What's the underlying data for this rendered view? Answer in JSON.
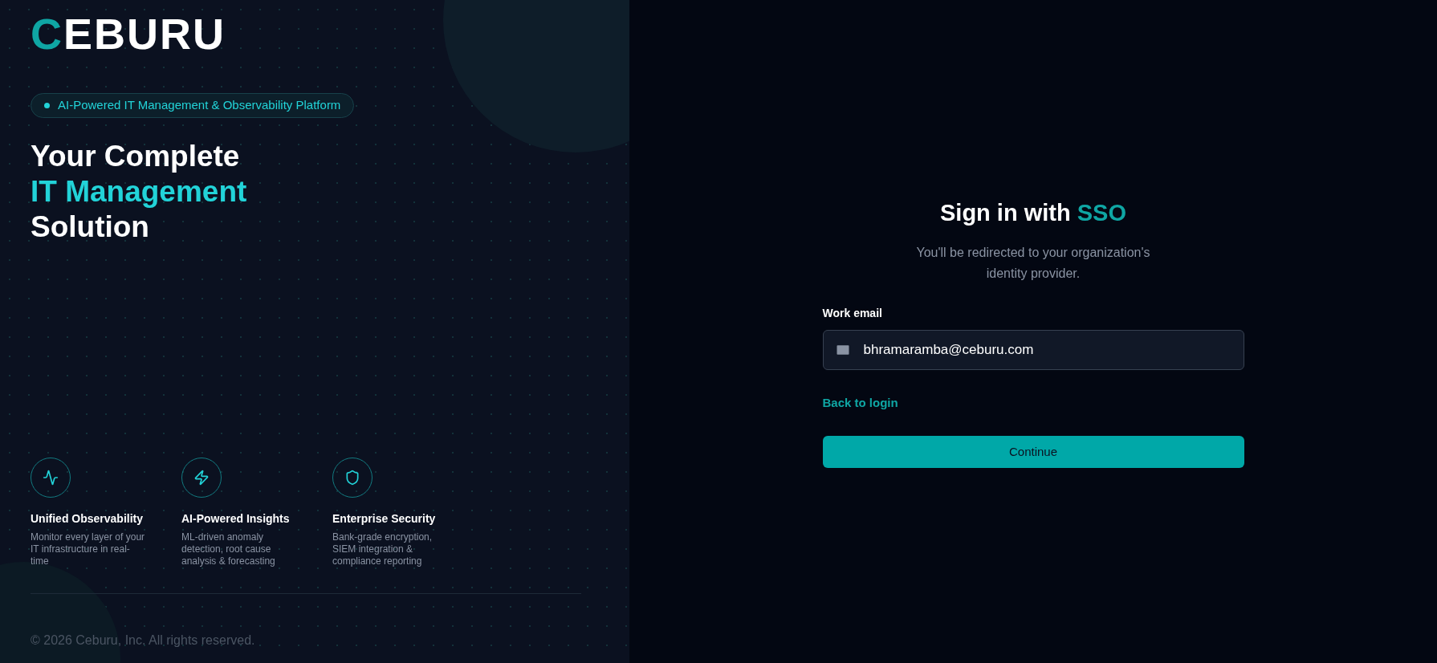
{
  "brand": {
    "logo_accent": "C",
    "logo_rest": "EBURU"
  },
  "hero": {
    "badge": "AI-Powered IT Management & Observability Platform",
    "headline": [
      {
        "text": "Your Complete",
        "accent": false
      },
      {
        "text": "IT Management",
        "accent": true
      },
      {
        "text": "Solution",
        "accent": false
      }
    ]
  },
  "features": [
    {
      "kind": "pulse",
      "title": "Unified Observability",
      "description": "Monitor every layer of your IT infrastructure in real-time"
    },
    {
      "kind": "bolt",
      "title": "AI-Powered Insights",
      "description": "ML-driven anomaly detection, root cause analysis & forecasting"
    },
    {
      "kind": "shield",
      "title": "Enterprise Security",
      "description": "Bank-grade encryption, SIEM integration & compliance reporting"
    }
  ],
  "footer": "© 2026 Ceburu, Inc. All rights reserved.",
  "sso": {
    "title": [
      {
        "text": "Sign in with",
        "accent": false
      },
      {
        "text": "SSO",
        "accent": true
      }
    ],
    "subtitle": "You'll be redirected to your organization's identity provider.",
    "email_label": "Work email",
    "email_value": "bhramaramba@ceburu.com",
    "back_link": "Back to login",
    "continue_button": "Continue"
  }
}
